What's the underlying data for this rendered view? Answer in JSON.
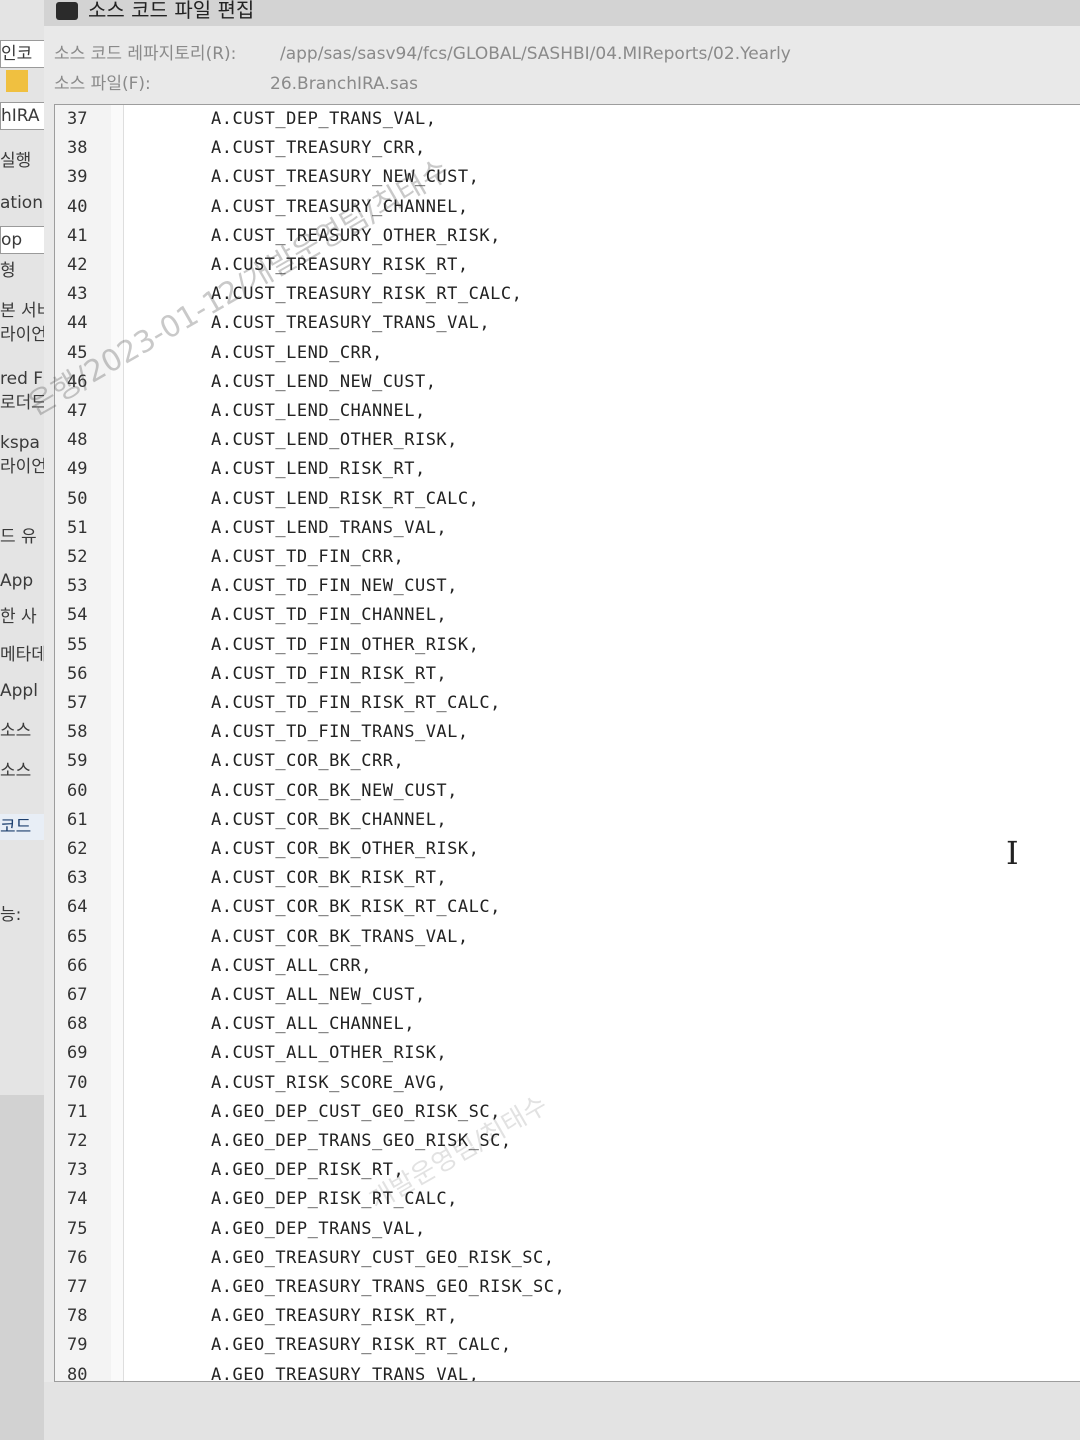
{
  "background_app": {
    "fragments": [
      "인코",
      "hIRA",
      "실행",
      "ation",
      "op",
      "형",
      "본 서비",
      "라이언",
      "red F",
      "로더드",
      "kspa",
      "라이언",
      "드 유",
      "App",
      "한 사",
      "메타데",
      "Appl",
      "소스",
      "소스",
      "코드",
      "능:"
    ]
  },
  "dialog": {
    "title": "소스 코드 파일 편집",
    "repository_label": "소스 코드 레파지토리(R):",
    "repository_path": "/app/sas/sasv94/fcs/GLOBAL/SASHBI/04.MIReports/02.Yearly",
    "file_label": "소스 파일(F):",
    "file_name": "26.BranchIRA.sas"
  },
  "editor": {
    "lines": [
      {
        "num": "37",
        "code": "A.CUST_DEP_TRANS_VAL,"
      },
      {
        "num": "38",
        "code": "A.CUST_TREASURY_CRR,"
      },
      {
        "num": "39",
        "code": "A.CUST_TREASURY_NEW_CUST,"
      },
      {
        "num": "40",
        "code": "A.CUST_TREASURY_CHANNEL,"
      },
      {
        "num": "41",
        "code": "A.CUST_TREASURY_OTHER_RISK,"
      },
      {
        "num": "42",
        "code": "A.CUST_TREASURY_RISK_RT,"
      },
      {
        "num": "43",
        "code": "A.CUST_TREASURY_RISK_RT_CALC,"
      },
      {
        "num": "44",
        "code": "A.CUST_TREASURY_TRANS_VAL,"
      },
      {
        "num": "45",
        "code": "A.CUST_LEND_CRR,"
      },
      {
        "num": "46",
        "code": "A.CUST_LEND_NEW_CUST,"
      },
      {
        "num": "47",
        "code": "A.CUST_LEND_CHANNEL,"
      },
      {
        "num": "48",
        "code": "A.CUST_LEND_OTHER_RISK,"
      },
      {
        "num": "49",
        "code": "A.CUST_LEND_RISK_RT,"
      },
      {
        "num": "50",
        "code": "A.CUST_LEND_RISK_RT_CALC,"
      },
      {
        "num": "51",
        "code": "A.CUST_LEND_TRANS_VAL,"
      },
      {
        "num": "52",
        "code": "A.CUST_TD_FIN_CRR,"
      },
      {
        "num": "53",
        "code": "A.CUST_TD_FIN_NEW_CUST,"
      },
      {
        "num": "54",
        "code": "A.CUST_TD_FIN_CHANNEL,"
      },
      {
        "num": "55",
        "code": "A.CUST_TD_FIN_OTHER_RISK,"
      },
      {
        "num": "56",
        "code": "A.CUST_TD_FIN_RISK_RT,"
      },
      {
        "num": "57",
        "code": "A.CUST_TD_FIN_RISK_RT_CALC,"
      },
      {
        "num": "58",
        "code": "A.CUST_TD_FIN_TRANS_VAL,"
      },
      {
        "num": "59",
        "code": "A.CUST_COR_BK_CRR,"
      },
      {
        "num": "60",
        "code": "A.CUST_COR_BK_NEW_CUST,"
      },
      {
        "num": "61",
        "code": "A.CUST_COR_BK_CHANNEL,"
      },
      {
        "num": "62",
        "code": "A.CUST_COR_BK_OTHER_RISK,"
      },
      {
        "num": "63",
        "code": "A.CUST_COR_BK_RISK_RT,"
      },
      {
        "num": "64",
        "code": "A.CUST_COR_BK_RISK_RT_CALC,"
      },
      {
        "num": "65",
        "code": "A.CUST_COR_BK_TRANS_VAL,"
      },
      {
        "num": "66",
        "code": "A.CUST_ALL_CRR,"
      },
      {
        "num": "67",
        "code": "A.CUST_ALL_NEW_CUST,"
      },
      {
        "num": "68",
        "code": "A.CUST_ALL_CHANNEL,"
      },
      {
        "num": "69",
        "code": "A.CUST_ALL_OTHER_RISK,"
      },
      {
        "num": "70",
        "code": "A.CUST_RISK_SCORE_AVG,"
      },
      {
        "num": "71",
        "code": "A.GEO_DEP_CUST_GEO_RISK_SC,"
      },
      {
        "num": "72",
        "code": "A.GEO_DEP_TRANS_GEO_RISK_SC,"
      },
      {
        "num": "73",
        "code": "A.GEO_DEP_RISK_RT,"
      },
      {
        "num": "74",
        "code": "A.GEO_DEP_RISK_RT_CALC,"
      },
      {
        "num": "75",
        "code": "A.GEO_DEP_TRANS_VAL,"
      },
      {
        "num": "76",
        "code": "A.GEO_TREASURY_CUST_GEO_RISK_SC,"
      },
      {
        "num": "77",
        "code": "A.GEO_TREASURY_TRANS_GEO_RISK_SC,"
      },
      {
        "num": "78",
        "code": "A.GEO_TREASURY_RISK_RT,"
      },
      {
        "num": "79",
        "code": "A.GEO_TREASURY_RISK_RT_CALC,"
      },
      {
        "num": "80",
        "code": "A.GEO_TREASURY_TRANS_VAL,"
      }
    ]
  },
  "watermarks": {
    "top": "은행/2023-01-12/개발운영팀/최태수",
    "bottom": "개발운영팀/최태수"
  }
}
